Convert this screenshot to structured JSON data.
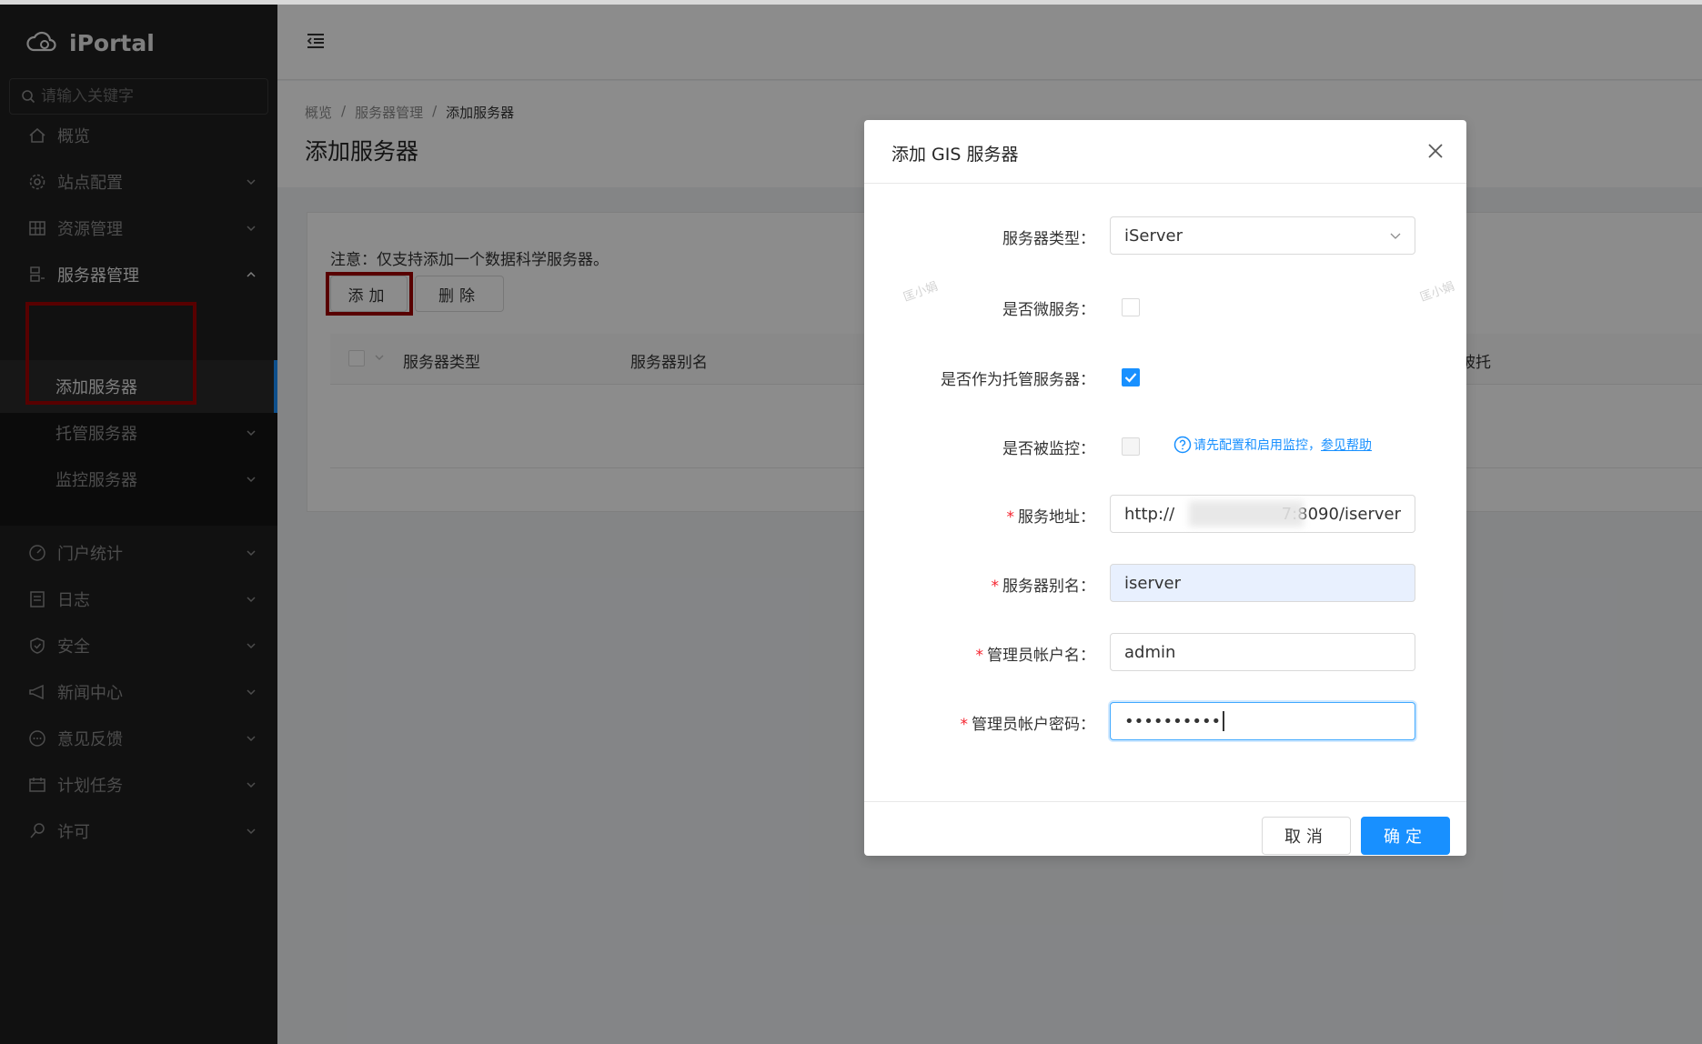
{
  "app": {
    "name": "iPortal"
  },
  "sidebar": {
    "search_placeholder": "请输入关键字",
    "items": [
      {
        "label": "概览",
        "icon": "home-icon"
      },
      {
        "label": "站点配置",
        "icon": "gear-icon"
      },
      {
        "label": "资源管理",
        "icon": "grid-icon"
      },
      {
        "label": "服务器管理",
        "icon": "server-icon"
      },
      {
        "label": "门户统计",
        "icon": "dashboard-icon"
      },
      {
        "label": "日志",
        "icon": "log-icon"
      },
      {
        "label": "安全",
        "icon": "shield-icon"
      },
      {
        "label": "新闻中心",
        "icon": "megaphone-icon"
      },
      {
        "label": "意见反馈",
        "icon": "chat-icon"
      },
      {
        "label": "计划任务",
        "icon": "calendar-icon"
      },
      {
        "label": "许可",
        "icon": "key-icon"
      }
    ],
    "submenu": [
      {
        "label": "添加服务器"
      },
      {
        "label": "托管服务器"
      },
      {
        "label": "监控服务器"
      }
    ]
  },
  "breadcrumb": [
    "概览",
    "服务器管理",
    "添加服务器"
  ],
  "breadcrumb_sep": "/",
  "page": {
    "title": "添加服务器",
    "note": "注意：仅支持添加一个数据科学服务器。",
    "add_label": "添加",
    "delete_label": "删除"
  },
  "table": {
    "columns": [
      "服务器类型",
      "服务器别名",
      "已被托"
    ]
  },
  "modal": {
    "title": "添加 GIS 服务器",
    "fields": {
      "server_type": {
        "label": "服务器类型：",
        "value": "iServer"
      },
      "micro_service": {
        "label": "是否微服务：",
        "checked": false
      },
      "hosted": {
        "label": "是否作为托管服务器：",
        "checked": true
      },
      "monitored": {
        "label": "是否被监控：",
        "checked": false,
        "help_text": "请先配置和启用监控，",
        "help_link": "参见帮助"
      },
      "service_url": {
        "label": "服务地址：",
        "value_prefix": "http://",
        "value_suffix": "7:8090/iserver"
      },
      "alias": {
        "label": "服务器别名：",
        "value": "iserver"
      },
      "admin_user": {
        "label": "管理员帐户名：",
        "value": "admin"
      },
      "admin_password": {
        "label": "管理员帐户密码：",
        "value": "••••••••••"
      }
    },
    "cancel_label": "取消",
    "ok_label": "确定"
  },
  "watermark": "匡小娟",
  "colors": {
    "primary": "#1890ff",
    "sidebar": "#1f1f1f",
    "highlight_box": "#a00000",
    "required": "#f5222d"
  }
}
